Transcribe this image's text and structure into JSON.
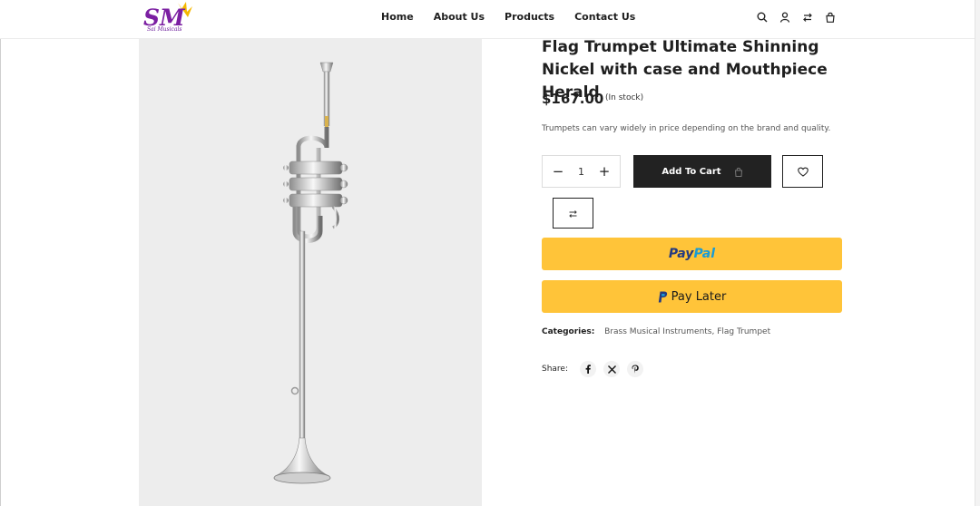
{
  "brand": {
    "logo_text": "SM",
    "tagline": "Sai Musicals"
  },
  "nav": {
    "items": [
      "Home",
      "About Us",
      "Products",
      "Contact Us"
    ]
  },
  "header_icons": [
    "search-icon",
    "user-icon",
    "compare-icon",
    "bag-icon"
  ],
  "product": {
    "title": "Flag Trumpet Ultimate Shinning Nickel with case and Mouthpiece Herald",
    "price": "$167.00",
    "stock": "(In stock)",
    "description": "Trumpets can vary widely in price depending on the brand and quality.",
    "quantity": "1",
    "add_to_cart": "Add To Cart"
  },
  "payments": {
    "paypal_pay": "Pay",
    "paypal_pal": "Pal",
    "pay_later": "Pay Later"
  },
  "categories": {
    "label": "Categories:",
    "value": "Brass Musical Instruments, Flag Trumpet"
  },
  "share": {
    "label": "Share:",
    "networks": [
      "facebook-icon",
      "x-icon",
      "pinterest-icon"
    ]
  },
  "colors": {
    "paypal_yellow": "#ffc439",
    "button_dark": "#222222",
    "brand_purple": "#7b1fa2",
    "brand_gold": "#f5b800"
  }
}
